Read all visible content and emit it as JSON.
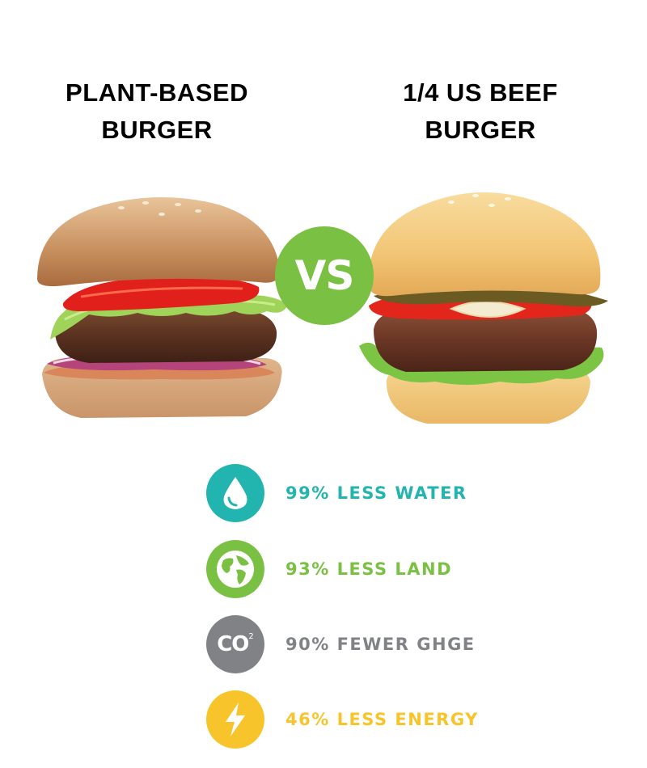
{
  "left": {
    "title_line1": "PLANT-BASED",
    "title_line2": "BURGER"
  },
  "right": {
    "title_line1": "1/4 US BEEF",
    "title_line2": "BURGER"
  },
  "vs_label": "VS",
  "stats": [
    {
      "label": "99% LESS WATER",
      "icon": "water-drop-icon",
      "color": "#22b5b0"
    },
    {
      "label": "93% LESS LAND",
      "icon": "globe-icon",
      "color": "#7ac143"
    },
    {
      "label": "90% FEWER GHGE",
      "icon": "co2-icon",
      "icon_text": "CO",
      "icon_sup": "2",
      "color": "#808285"
    },
    {
      "label": "46% LESS ENERGY",
      "icon": "lightning-bolt-icon",
      "color": "#f7c52b"
    }
  ],
  "colors": {
    "vs_badge": "#7ac143",
    "water": "#22b5b0",
    "land": "#7ac143",
    "ghge": "#808285",
    "energy": "#f7c52b"
  }
}
